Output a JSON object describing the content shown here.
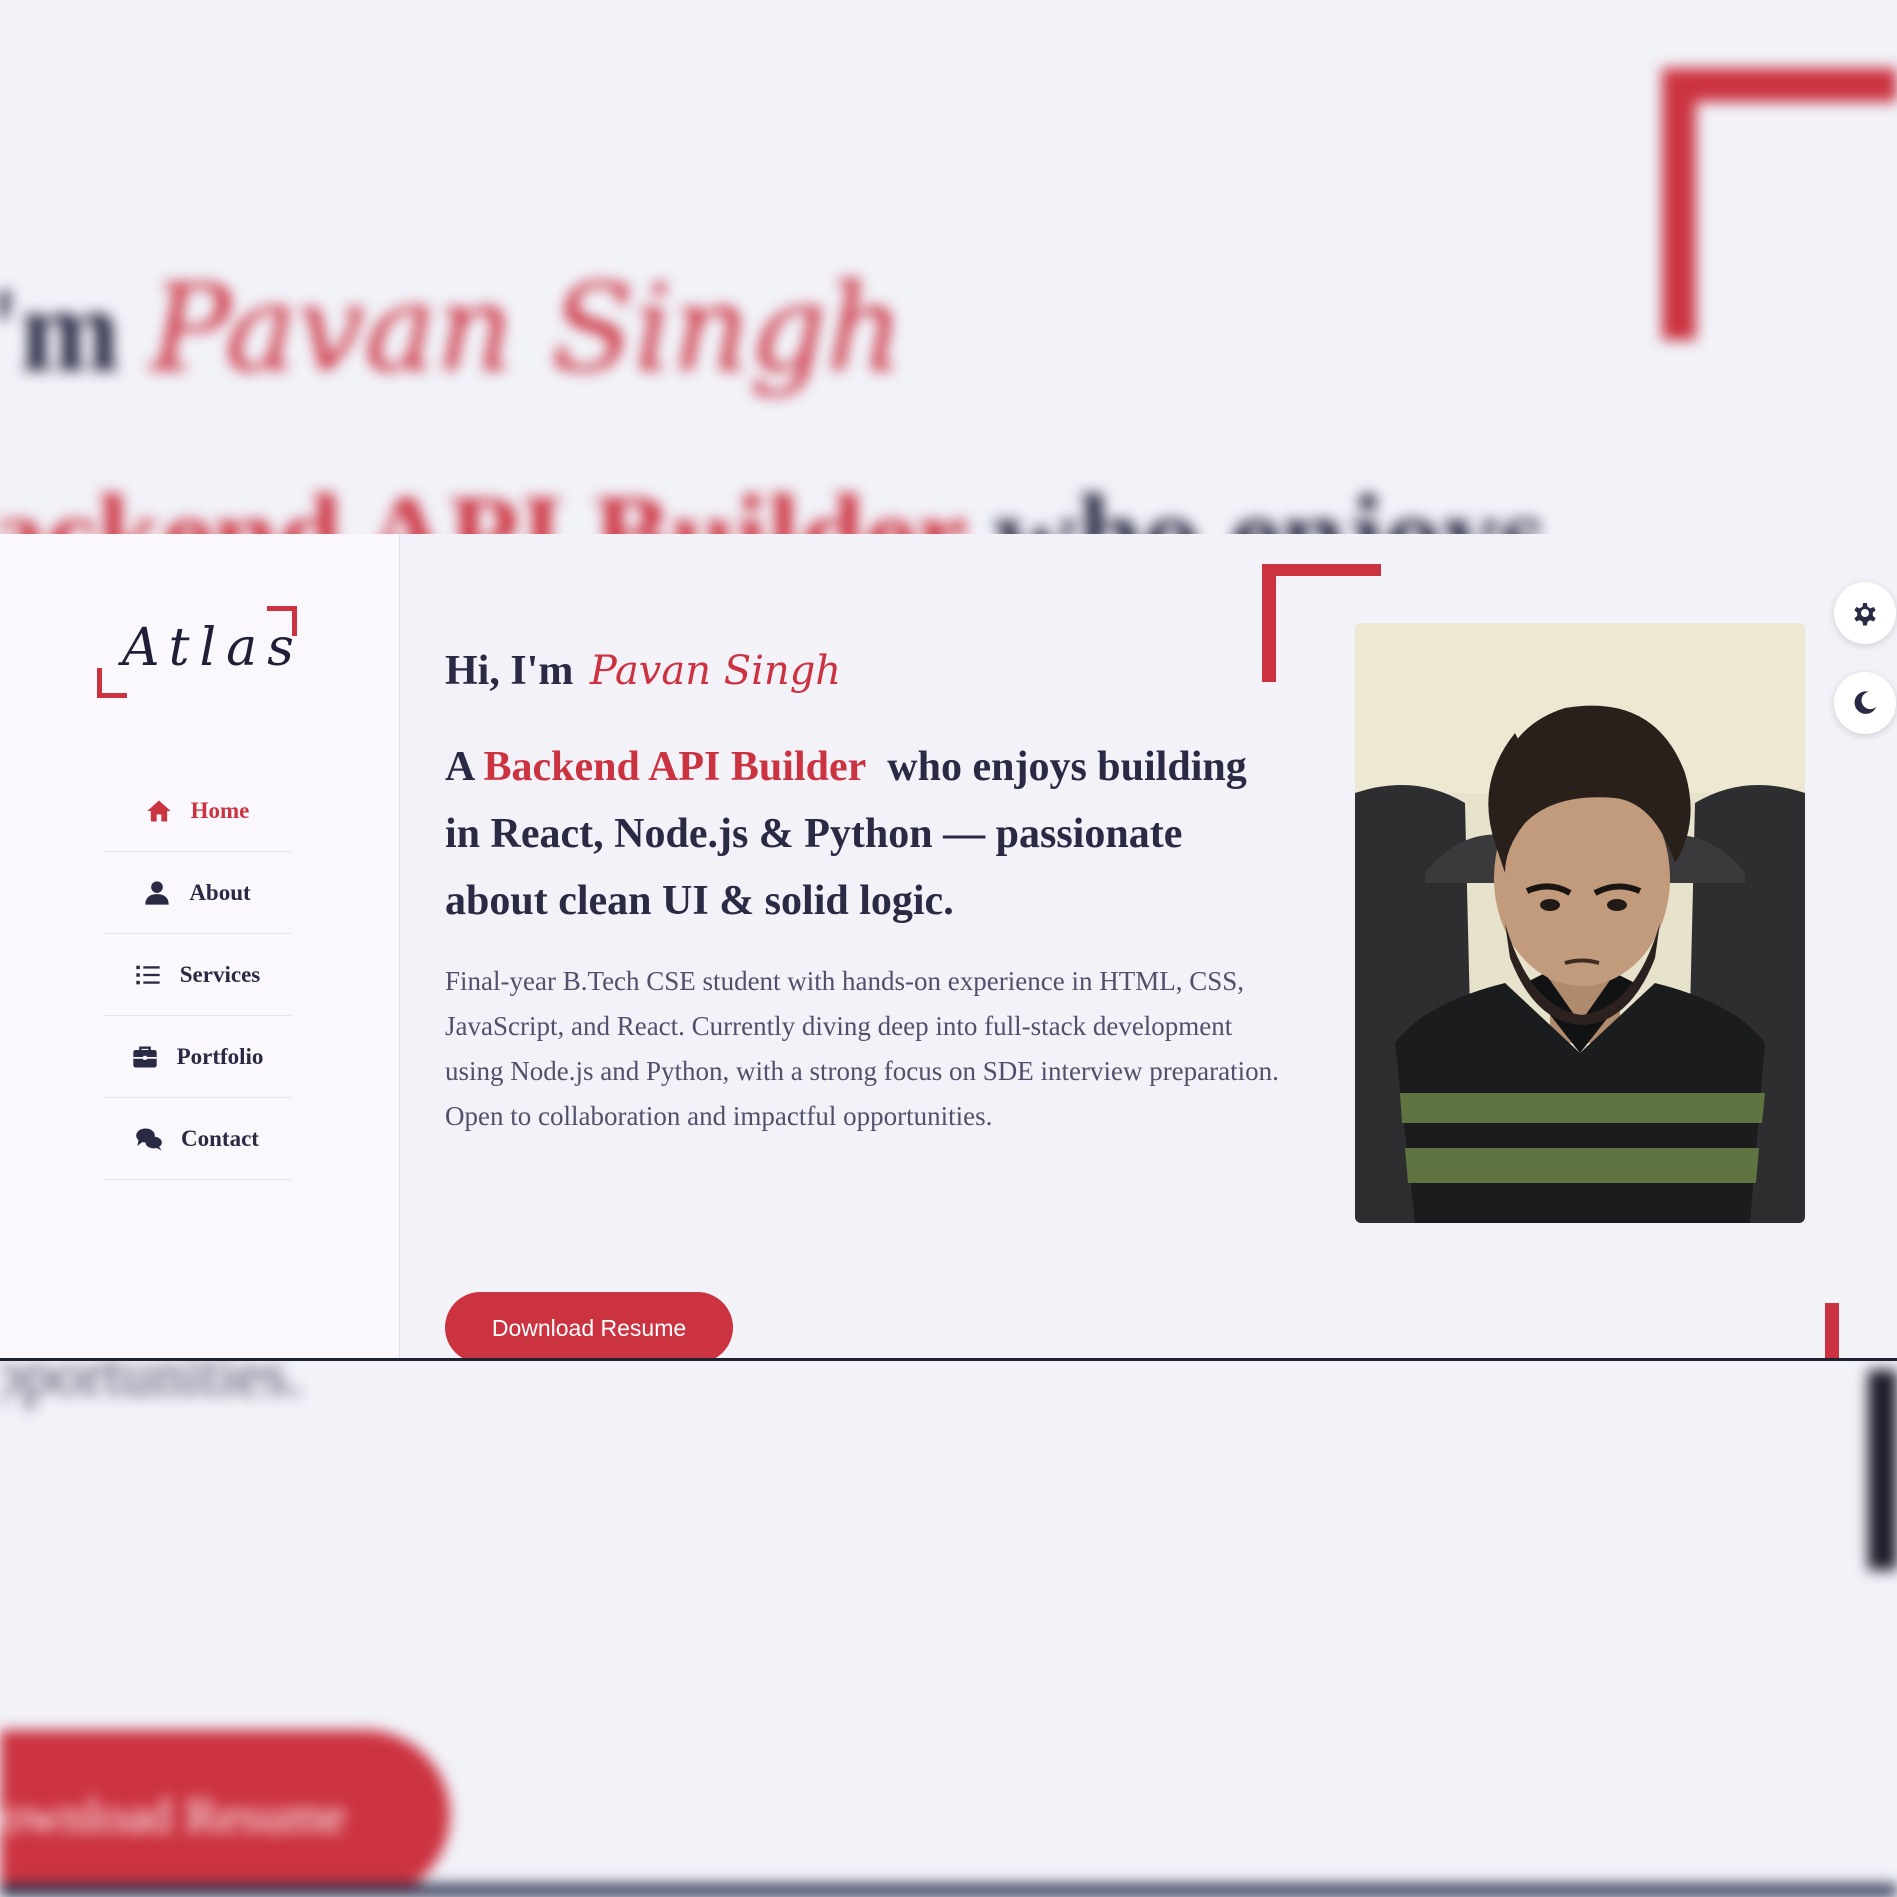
{
  "background": {
    "greeting": "I'm",
    "name": "Pavan Singh",
    "headline_highlight": "Backend API Builder",
    "headline_rest": "who enjoys",
    "text_line": "opportunities.",
    "button": "Download Resume"
  },
  "sidebar": {
    "logo": "Atlas",
    "nav": [
      {
        "label": "Home",
        "icon": "home-icon",
        "active": true
      },
      {
        "label": "About",
        "icon": "user-icon",
        "active": false
      },
      {
        "label": "Services",
        "icon": "list-icon",
        "active": false
      },
      {
        "label": "Portfolio",
        "icon": "briefcase-icon",
        "active": false
      },
      {
        "label": "Contact",
        "icon": "comments-icon",
        "active": false
      }
    ]
  },
  "hero": {
    "greeting": "Hi, I'm",
    "name": "Pavan Singh",
    "headline_prefix": "A",
    "headline_highlight": "Backend API Builder",
    "headline_rest": "who enjoys building in React, Node.js & Python — passionate about clean UI & solid logic.",
    "description": "Final-year B.Tech CSE student with hands-on experience in HTML, CSS, JavaScript, and React. Currently diving deep into full-stack development using Node.js and Python, with a strong focus on SDE interview preparation. Open to collaboration and impactful opportunities.",
    "button_label": "Download Resume"
  },
  "floating": {
    "settings_icon": "gear-icon",
    "theme_icon": "moon-icon"
  },
  "colors": {
    "accent": "#cc3341",
    "text": "#2a2a44",
    "muted": "#50506a",
    "background": "#f3f2f9",
    "sidebar": "#faf8fc"
  }
}
